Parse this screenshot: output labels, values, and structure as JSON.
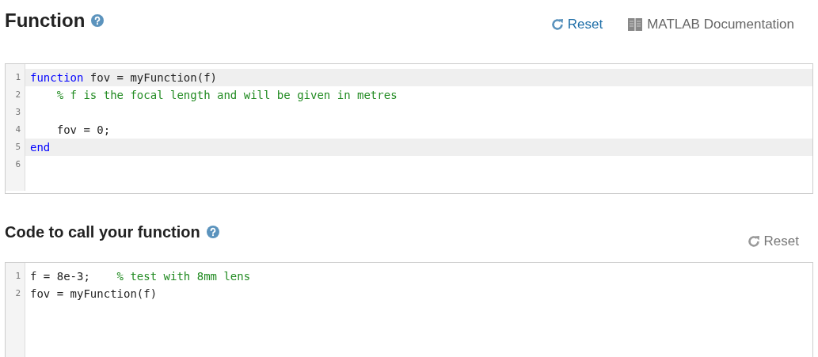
{
  "function_section": {
    "title": "Function",
    "reset": {
      "label": "Reset",
      "disabled": false
    },
    "documentation_link": "MATLAB Documentation",
    "editor": {
      "lines": [
        {
          "number": "1",
          "highlighted": true,
          "tokens": [
            {
              "kind": "keyword",
              "text": "function"
            },
            {
              "kind": "plain",
              "text": " fov = myFunction(f)"
            }
          ]
        },
        {
          "number": "2",
          "highlighted": false,
          "tokens": [
            {
              "kind": "comment",
              "text": "    % f is the focal length and will be given in metres"
            }
          ]
        },
        {
          "number": "3",
          "highlighted": false
        },
        {
          "number": "4",
          "highlighted": false,
          "tokens": [
            {
              "kind": "plain",
              "text": "    fov = 0;"
            }
          ]
        },
        {
          "number": "5",
          "highlighted": true,
          "tokens": [
            {
              "kind": "keyword",
              "text": "end"
            }
          ]
        },
        {
          "number": "6",
          "highlighted": false
        }
      ]
    }
  },
  "call_section": {
    "title": "Code to call your function",
    "reset": {
      "label": "Reset",
      "disabled": true
    },
    "editor": {
      "lines": [
        {
          "number": "1",
          "highlighted": false,
          "tokens": [
            {
              "kind": "plain",
              "text": "f = 8e-3;    "
            },
            {
              "kind": "comment",
              "text": "% test with 8mm lens"
            }
          ]
        },
        {
          "number": "2",
          "highlighted": false,
          "tokens": [
            {
              "kind": "plain",
              "text": "fov = myFunction(f)"
            }
          ]
        }
      ]
    }
  }
}
